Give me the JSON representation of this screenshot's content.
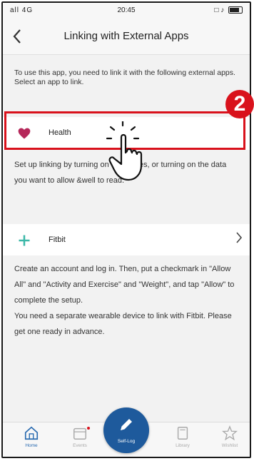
{
  "status_bar": {
    "left": "all 4G",
    "time": "20:45",
    "right": "□ ♪"
  },
  "nav": {
    "back_icon": "chevron-left-icon",
    "title": "Linking with External Apps"
  },
  "intro_text": "To use this app, you need to link it with the following external apps. Select an app to link.",
  "apps": [
    {
      "icon": "heart-icon",
      "icon_color": "#b5285a",
      "label": "Health",
      "description": "Set up linking by turning on categories, or turning on the data you want to allow &well to read."
    },
    {
      "icon": "fitbit-plus-icon",
      "icon_color": "#3cb8a8",
      "label": "Fitbit",
      "description": "Create an account and log in. Then, put a checkmark in \"Allow All\" and \"Activity and Exercise\" and \"Weight\", and tap \"Allow\" to complete the setup.\nYou need a separate wearable device to link with Fitbit. Please get one ready in advance."
    }
  ],
  "annotation": {
    "step_number": "2",
    "highlight_color": "#d9121c"
  },
  "tabs": [
    {
      "label": "Home",
      "icon": "home-icon",
      "active": true
    },
    {
      "label": "Events",
      "icon": "calendar-icon",
      "active": false
    },
    {
      "label": "Self-Log",
      "icon": "pencil-icon",
      "active": false
    },
    {
      "label": "Library",
      "icon": "book-icon",
      "active": false
    },
    {
      "label": "Wishlist",
      "icon": "star-icon",
      "active": false
    }
  ],
  "colors": {
    "accent": "#1e5a9c",
    "background": "#f2f2f2"
  }
}
